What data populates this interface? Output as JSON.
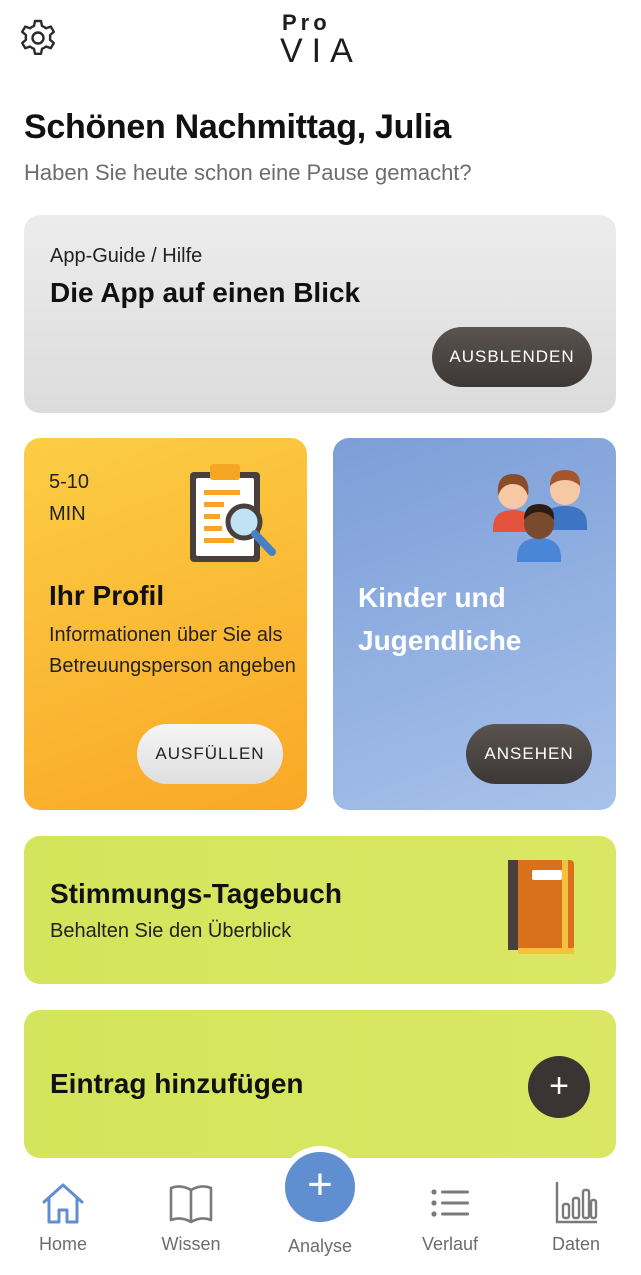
{
  "logo": {
    "top": "Pro",
    "bottom": "VIA"
  },
  "greeting": "Schönen Nachmittag, Julia",
  "subgreeting": "Haben Sie heute schon eine Pause gemacht?",
  "guide_card": {
    "kicker": "App-Guide / Hilfe",
    "title": "Die App auf einen Blick",
    "button": "AUSBLENDEN"
  },
  "profile_card": {
    "time_line1": "5-10",
    "time_line2": "MIN",
    "title": "Ihr Profil",
    "description": "Informationen über Sie als Betreuungsperson angeben",
    "button": "AUSFÜLLEN"
  },
  "kids_card": {
    "title": "Kinder und Jugendliche",
    "button": "ANSEHEN"
  },
  "mood_card": {
    "title": "Stimmungs-Tagebuch",
    "subtitle": "Behalten Sie den Überblick"
  },
  "entry_card": {
    "title": "Eintrag hinzufügen",
    "plus": "+"
  },
  "nav": {
    "home": "Home",
    "wissen": "Wissen",
    "analyse": "Analyse",
    "verlauf": "Verlauf",
    "daten": "Daten",
    "fab": "+"
  },
  "colors": {
    "accent_blue": "#5f8fd0",
    "profile_yellow": "#fbbd35",
    "kids_blue": "#8fb0e0",
    "lime": "#d6e660",
    "dark_button": "#3d3836"
  },
  "icons": {
    "settings": "gear-icon",
    "home": "home-icon",
    "wissen": "book-open-icon",
    "verlauf": "list-icon",
    "daten": "bar-chart-icon"
  }
}
